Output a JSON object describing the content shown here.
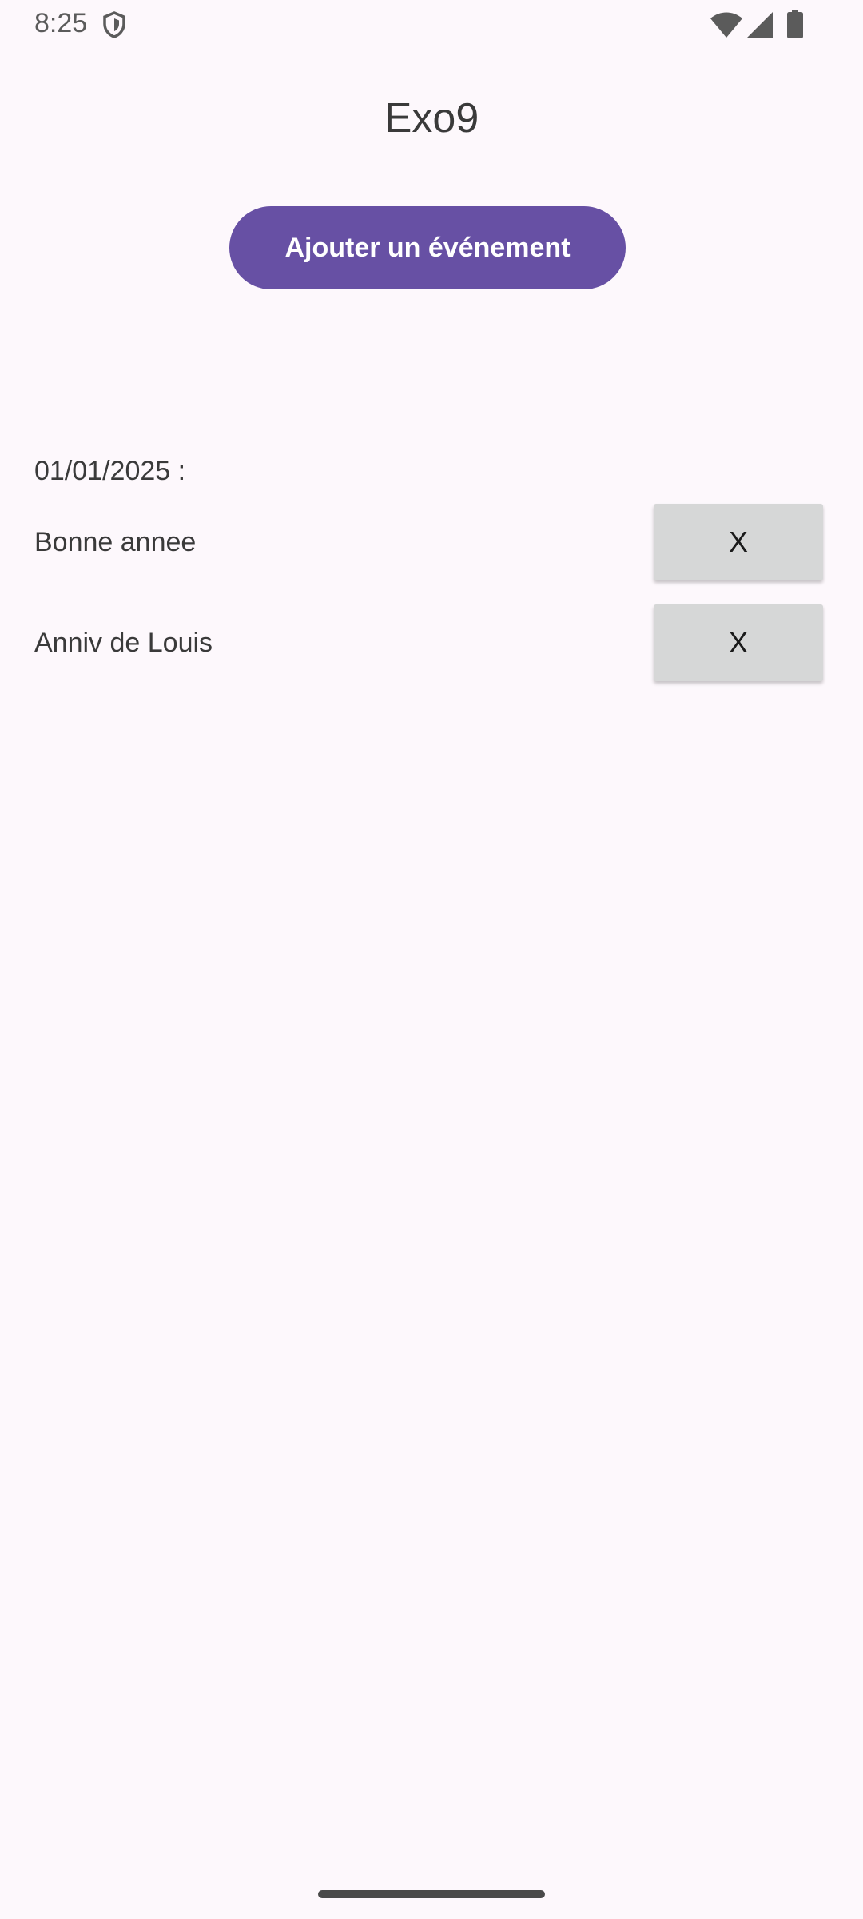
{
  "status_bar": {
    "time": "8:25",
    "icons": [
      "shield-icon",
      "wifi-icon",
      "signal-icon",
      "battery-icon"
    ]
  },
  "app": {
    "title": "Exo9"
  },
  "actions": {
    "add_event_label": "Ajouter un événement"
  },
  "events": {
    "date": "01/01/2025 :",
    "items": [
      {
        "label": "Bonne annee",
        "delete_label": "X"
      },
      {
        "label": "Anniv de Louis",
        "delete_label": "X"
      }
    ]
  },
  "colors": {
    "primary": "#6750a4",
    "background": "#fdf8fc",
    "delete_button": "#d6d7d7",
    "text": "#3a3a3a"
  }
}
